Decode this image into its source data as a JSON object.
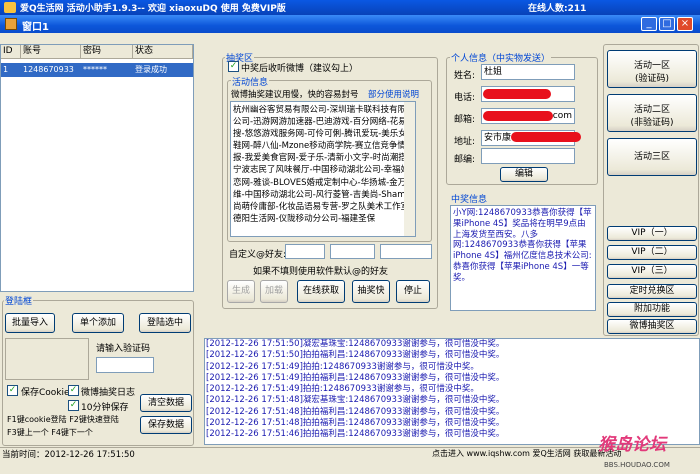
{
  "outer_title": "爱Q生活网 活动小助手1.9.3-- 欢迎 xiaoxuDQ 使用 免费VIP版",
  "online_count": "在线人数:211",
  "window_title": "窗口1",
  "window_controls": {
    "minimize": "_",
    "maximize": "□",
    "close": "×"
  },
  "accounts": {
    "columns": [
      "ID",
      "账号",
      "密码",
      "状态"
    ],
    "rows": [
      {
        "id": "1",
        "account": "1248670933",
        "password": "******",
        "status": "登录成功"
      }
    ]
  },
  "login": {
    "group_title": "登陆框",
    "batch_import": "批量导入",
    "add_single": "单个添加",
    "login_selected": "登陆选中",
    "captcha_label": "请输入验证码",
    "save_cookie": "保存Cookie",
    "weibo_log": "微博抽奖日志",
    "save_10min": "10分钟保存",
    "clear_data": "清空数据",
    "save_data": "保存数据",
    "hotkey_line1": "F1键cookie登陆 F2键快速登陆",
    "hotkey_line2": "F3键上一个   F4键下一个"
  },
  "lottery": {
    "group_title": "抽奖区",
    "follow_checkbox": "中奖后收听微博（建议勾上）",
    "activity_title": "活动信息",
    "activity_hint": "微博抽奖建议用慢，快的容易封号",
    "partial_note": "部分使用说明",
    "ad_text": "杭州幽谷客贸易有限公司-深圳瑞卡联科技有限公司-迅游网游加速器-巴迪游戏-百分网络-花易搜-悠悠游戏服务网-可伶可俐-腾讯爱玩-美乐女鞋网-醉八仙-Mzone移动商学院-赛立信竞争情报-我爱美食官网-爱子乐-清新小文字-时尚潮搭-宁波志民了风味餐厅-中国移动湖北公司-幸福婚恋网-雅谈-BLOVES婚戒定制中心-华扬城-金万维-中国移动湖北公司-风行菱管-吉美尚-Shame尚萌伶庸部-化妆品语易专营-罗之队美术工作室-德阳生活网-仪陇移动分公司-福建圣保",
    "custom_follow_label": "自定义@好友:",
    "default_follow_hint": "如果不填则使用软件默认@的好友",
    "btn_generate": "生成",
    "btn_load": "加载",
    "btn_online_get": "在线获取",
    "btn_lottery_fast": "抽奖快",
    "btn_stop": "停止"
  },
  "personal": {
    "group_title": "个人信息（中实物发送）",
    "name_label": "姓名:",
    "name_value": "杜姐",
    "phone_label": "电话:",
    "email_label": "邮箱:",
    "email_value_suffix": "com",
    "address_label": "地址:",
    "address_value": "安市康",
    "postcode_label": "邮编:",
    "edit_button": "编辑"
  },
  "winners": {
    "group_title": "中奖信息",
    "text": "小Y网:1248670933恭喜你获得【苹果iPhone 4S】奖品将在明早9点由上海发货至西安。八多网:1248670933恭喜你获得【苹果iPhone 4S】福州亿度信息技术公司:恭喜你获得【苹果iPhone 4S】一等奖。"
  },
  "right_panel": {
    "activity1": "活动一区\n(验证码)",
    "activity2": "活动二区\n(非验证码)",
    "activity3": "活动三区",
    "vip1": "VIP（一）",
    "vip2": "VIP（二）",
    "vip3": "VIP（三）",
    "custom_zone": "定时兑换区",
    "addon": "附加功能",
    "weibo_lottery": "微博抽奖区"
  },
  "log": [
    "[2012-12-26 17:51:50]凝宏基珠宝:1248670933谢谢参与，很可惜没中奖。",
    "[2012-12-26 17:51:50]拍拍福利昌:1248670933谢谢参与，很可惜没中奖。",
    "[2012-12-26 17:51:49]拍拍:1248670933谢谢参与，很可惜没中奖。",
    "[2012-12-26 17:51:49]拍拍福利昌:1248670933谢谢参与，很可惜没中奖。",
    "[2012-12-26 17:51:49]拍拍:1248670933谢谢参与，很可惜没中奖。",
    "[2012-12-26 17:51:48]凝宏基珠宝:1248670933谢谢参与，很可惜没中奖。",
    "[2012-12-26 17:51:48]拍拍福利昌:1248670933谢谢参与，很可惜没中奖。",
    "[2012-12-26 17:51:48]拍拍福利昌:1248670933谢谢参与，很可惜没中奖。",
    "[2012-12-26 17:51:46]拍拍福利昌:1248670933谢谢参与，很可惜没中奖。"
  ],
  "status_bar": {
    "time": "当前时间：2012-12-26 17:51:50",
    "link_text": "点击进入 www.iqshw.com 爱Q生活网 获取最新活动",
    "watermark": "猴岛论坛",
    "watermark_url": "BBS.HOUDAO.COM"
  }
}
